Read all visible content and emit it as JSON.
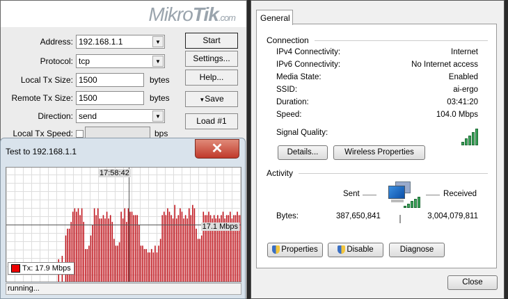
{
  "mikrotik": {
    "logo": "MikroTik",
    "logo_suffix": ".com",
    "fields": [
      {
        "label": "Address:",
        "value": "192.168.1.1",
        "type": "select"
      },
      {
        "label": "Protocol:",
        "value": "tcp",
        "type": "select"
      },
      {
        "label": "Local Tx Size:",
        "value": "1500",
        "unit": "bytes",
        "type": "text"
      },
      {
        "label": "Remote Tx Size:",
        "value": "1500",
        "unit": "bytes",
        "type": "text"
      },
      {
        "label": "Direction:",
        "value": "send",
        "type": "select"
      },
      {
        "label": "Local Tx Speed:",
        "value": "",
        "unit": "bps",
        "type": "check"
      }
    ],
    "buttons": [
      "Start",
      "Settings...",
      "Help...",
      "Save",
      "Load #1"
    ]
  },
  "test_window": {
    "title": "Test to 192.168.1.1",
    "status": "running...",
    "cursor_time": "17:58:42",
    "cursor_value": "17.1 Mbps",
    "legend": "Tx: 17.9 Mbps"
  },
  "chart_data": {
    "type": "bar",
    "series": [
      {
        "name": "Tx",
        "color": "#c0141c",
        "values": [
          0,
          0,
          0,
          0,
          0,
          0,
          0,
          0,
          0,
          0,
          0,
          0,
          0,
          0,
          0,
          0,
          0,
          0,
          0,
          0,
          0,
          0,
          0,
          0,
          0,
          0,
          0,
          0,
          0,
          7,
          0,
          8,
          0,
          14,
          16,
          16,
          18,
          21,
          22,
          21,
          22,
          20,
          22,
          18,
          10,
          10,
          11,
          14,
          17,
          22,
          20,
          22,
          19,
          19,
          20,
          19,
          21,
          19,
          20,
          18,
          13,
          11,
          11,
          12,
          21,
          19,
          22,
          18,
          22,
          21,
          21,
          20,
          20,
          20,
          17,
          11,
          11,
          10,
          10,
          9,
          9,
          10,
          9,
          11,
          9,
          11,
          13,
          20,
          21,
          20,
          22,
          21,
          20,
          19,
          23,
          19,
          20,
          22,
          21,
          19,
          20,
          19,
          22,
          20,
          23,
          22,
          16,
          13,
          13,
          14,
          21,
          20,
          20,
          21,
          20,
          19,
          20,
          19,
          20,
          19,
          20,
          21,
          19,
          20,
          20,
          21,
          19,
          20,
          20,
          21,
          20,
          20
        ]
      }
    ],
    "ylim": [
      0,
      34
    ],
    "cursor_value": 17.1
  },
  "network": {
    "tab": "General",
    "connection_title": "Connection",
    "rows": [
      {
        "k": "IPv4 Connectivity:",
        "v": "Internet"
      },
      {
        "k": "IPv6 Connectivity:",
        "v": "No Internet access"
      },
      {
        "k": "Media State:",
        "v": "Enabled"
      },
      {
        "k": "SSID:",
        "v": "ai-ergo"
      },
      {
        "k": "Duration:",
        "v": "03:41:20"
      },
      {
        "k": "Speed:",
        "v": "104.0 Mbps"
      }
    ],
    "signal_label": "Signal Quality:",
    "signal_bars": 5,
    "details": "Details...",
    "wireless": "Wireless Properties",
    "activity_title": "Activity",
    "sent": "Sent",
    "received": "Received",
    "bytes_label": "Bytes:",
    "bytes_sent": "387,650,841",
    "bytes_received": "3,004,079,811",
    "properties": "Properties",
    "disable": "Disable",
    "diagnose": "Diagnose",
    "close": "Close"
  }
}
